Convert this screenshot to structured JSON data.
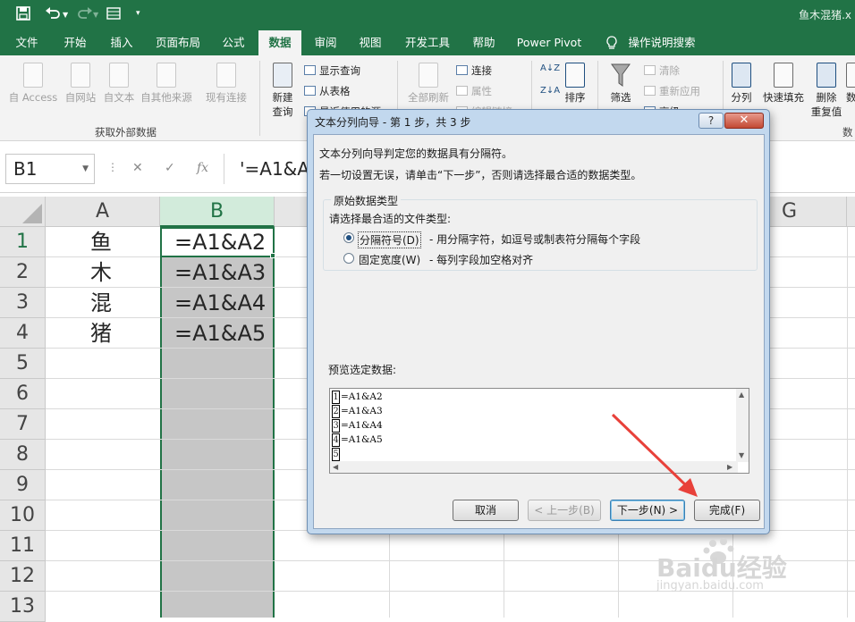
{
  "title_bar": {
    "doc_title": "鱼木混猪.x"
  },
  "tabs": [
    "文件",
    "开始",
    "插入",
    "页面布局",
    "公式",
    "数据",
    "审阅",
    "视图",
    "开发工具",
    "帮助",
    "Power Pivot",
    "操作说明搜索"
  ],
  "active_tab": "数据",
  "ribbon": {
    "get_external": {
      "buttons": [
        "自 Access",
        "自网站",
        "自文本",
        "自其他来源",
        "现有连接"
      ],
      "group_label": "获取外部数据"
    },
    "query": {
      "new_query_1": "新建",
      "new_query_2": "查询",
      "show_queries": "显示查询",
      "from_table": "从表格",
      "recent_sources": "最近使用的源"
    },
    "connections": {
      "refresh_all": "全部刷新",
      "connections": "连接",
      "properties": "属性",
      "edit_links": "编辑链接"
    },
    "sort": {
      "az": "A↓Z",
      "za": "Z↓A",
      "sort": "排序"
    },
    "filter": {
      "filter": "筛选",
      "clear": "清除",
      "reapply": "重新应用",
      "advanced": "高级"
    },
    "tools": {
      "split": "分列",
      "flash_fill": "快速填充",
      "remove_dup_1": "删除",
      "remove_dup_2": "重复值",
      "validate": "数",
      "group_label": "数"
    }
  },
  "formula_bar": {
    "name_box": "B1",
    "fx": "fx",
    "formula": "'=A1&A"
  },
  "sheet": {
    "columns": [
      "A",
      "B",
      "G"
    ],
    "rows": [
      "1",
      "2",
      "3",
      "4",
      "5",
      "6",
      "7",
      "8",
      "9",
      "10",
      "11",
      "12",
      "13"
    ],
    "col_a": [
      "鱼",
      "木",
      "混",
      "猪"
    ],
    "col_b": [
      "=A1&A2",
      "=A1&A3",
      "=A1&A4",
      "=A1&A5"
    ]
  },
  "dialog": {
    "title": "文本分列向导 - 第 1 步，共 3 步",
    "help": "?",
    "close": "✕",
    "line1": "文本分列向导判定您的数据具有分隔符。",
    "line2": "若一切设置无误，请单击“下一步”，否则请选择最合适的数据类型。",
    "group_title": "原始数据类型",
    "choose_label": "请选择最合适的文件类型:",
    "opt_delimited": "分隔符号(D)",
    "opt_delimited_desc": "- 用分隔字符，如逗号或制表符分隔每个字段",
    "opt_fixed": "固定宽度(W)",
    "opt_fixed_desc": "- 每列字段加空格对齐",
    "preview_label": "预览选定数据:",
    "preview_nums": [
      "1",
      "2",
      "3",
      "4",
      "5"
    ],
    "preview_lines": [
      "=A1&A2",
      "=A1&A3",
      "=A1&A4",
      "=A1&A5",
      ""
    ],
    "btn_cancel": "取消",
    "btn_back": "< 上一步(B)",
    "btn_next": "下一步(N) >",
    "btn_finish": "完成(F)"
  },
  "watermark": {
    "brand": "Baidu经验",
    "url": "jingyan.baidu.com"
  },
  "colors": {
    "excel_green": "#217346",
    "arrow_red": "#e8413a"
  }
}
